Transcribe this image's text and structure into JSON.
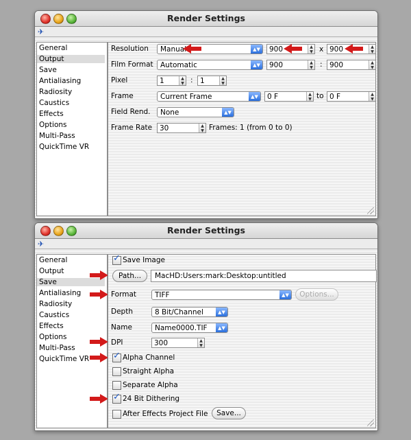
{
  "windows": [
    {
      "title": "Render Settings",
      "sidebar": [
        "General",
        "Output",
        "Save",
        "Antialiasing",
        "Radiosity",
        "Caustics",
        "Effects",
        "Options",
        "Multi-Pass",
        "QuickTime VR"
      ],
      "selected": "Output",
      "output": {
        "resolution_label": "Resolution",
        "resolution_value": "Manual",
        "res_w": "900",
        "res_x": "x",
        "res_h": "900",
        "film_label": "Film Format",
        "film_value": "Automatic",
        "film_w": "900",
        "film_sep": ":",
        "film_h": "900",
        "pixel_label": "Pixel",
        "pixel_a": "1",
        "pixel_sep": ":",
        "pixel_b": "1",
        "frame_label": "Frame",
        "frame_value": "Current Frame",
        "frame_from": "0 F",
        "frame_to_label": "to",
        "frame_to": "0 F",
        "field_label": "Field Rend.",
        "field_value": "None",
        "rate_label": "Frame Rate",
        "rate_value": "30",
        "frames_text": "Frames: 1 (from 0 to 0)"
      }
    },
    {
      "title": "Render Settings",
      "sidebar": [
        "General",
        "Output",
        "Save",
        "Antialiasing",
        "Radiosity",
        "Caustics",
        "Effects",
        "Options",
        "Multi-Pass",
        "QuickTime VR"
      ],
      "selected": "Save",
      "save": {
        "save_image_label": "Save Image",
        "save_image_checked": true,
        "path_button": "Path...",
        "path_value": "MacHD:Users:mark:Desktop:untitled",
        "format_label": "Format",
        "format_value": "TIFF",
        "options_button": "Options...",
        "depth_label": "Depth",
        "depth_value": "8 Bit/Channel",
        "name_label": "Name",
        "name_value": "Name0000.TIF",
        "dpi_label": "DPI",
        "dpi_value": "300",
        "alpha_label": "Alpha Channel",
        "alpha_checked": true,
        "straight_label": "Straight Alpha",
        "straight_checked": false,
        "separate_label": "Separate Alpha",
        "separate_checked": false,
        "dither_label": "24 Bit Dithering",
        "dither_checked": true,
        "ae_label": "After Effects Project File",
        "ae_checked": false,
        "save_button": "Save..."
      }
    }
  ],
  "colors": {
    "accent": "#2a6fdc",
    "arrow": "#d31a1a",
    "selection": "#dcdcdc"
  },
  "icons": {
    "toolbar": "pin-icon",
    "check": "checkmark-icon",
    "annotation": "red-arrow-icon"
  }
}
